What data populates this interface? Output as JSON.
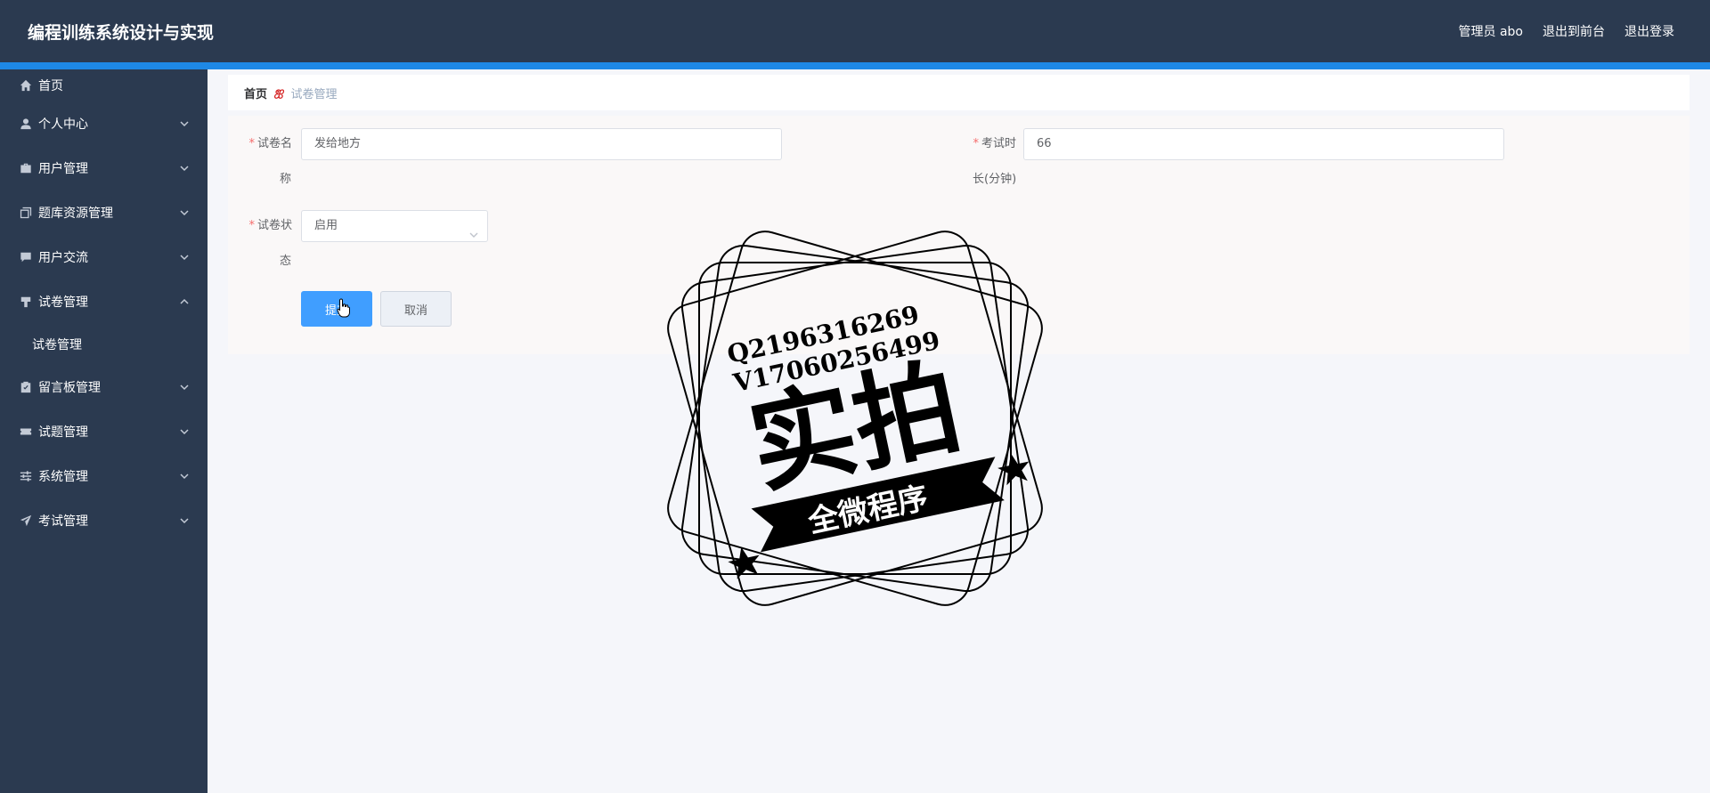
{
  "header": {
    "title": "编程训练系统设计与实现",
    "links": [
      "管理员 abo",
      "退出到前台",
      "退出登录"
    ]
  },
  "sidebar": {
    "items": [
      {
        "label": "首页",
        "icon": "home-icon",
        "expandable": false
      },
      {
        "label": "个人中心",
        "icon": "user-icon",
        "expandable": true
      },
      {
        "label": "用户管理",
        "icon": "briefcase-icon",
        "expandable": true
      },
      {
        "label": "题库资源管理",
        "icon": "copy-icon",
        "expandable": true
      },
      {
        "label": "用户交流",
        "icon": "chat-icon",
        "expandable": true
      },
      {
        "label": "试卷管理",
        "icon": "paper-icon",
        "expandable": true,
        "expanded": true,
        "children": [
          "试卷管理"
        ]
      },
      {
        "label": "留言板管理",
        "icon": "clipboard-icon",
        "expandable": true
      },
      {
        "label": "试题管理",
        "icon": "ticket-icon",
        "expandable": true
      },
      {
        "label": "系统管理",
        "icon": "sliders-icon",
        "expandable": true
      },
      {
        "label": "考试管理",
        "icon": "send-icon",
        "expandable": true
      }
    ]
  },
  "breadcrumb": {
    "home": "首页",
    "current": "试卷管理"
  },
  "form": {
    "name": {
      "label_line1": "试卷名",
      "label_line2": "称",
      "value": "发给地方"
    },
    "duration": {
      "label_line1": "考试时",
      "label_line2": "长(分钟)",
      "value": "66"
    },
    "status": {
      "label_line1": "试卷状",
      "label_line2": "态",
      "value": "启用"
    },
    "submit_label": "提交",
    "cancel_label": "取消"
  },
  "watermark": {
    "line1": "Q2196316269",
    "line2": "V17060256499",
    "main": "实拍",
    "banner": "全微程序"
  }
}
